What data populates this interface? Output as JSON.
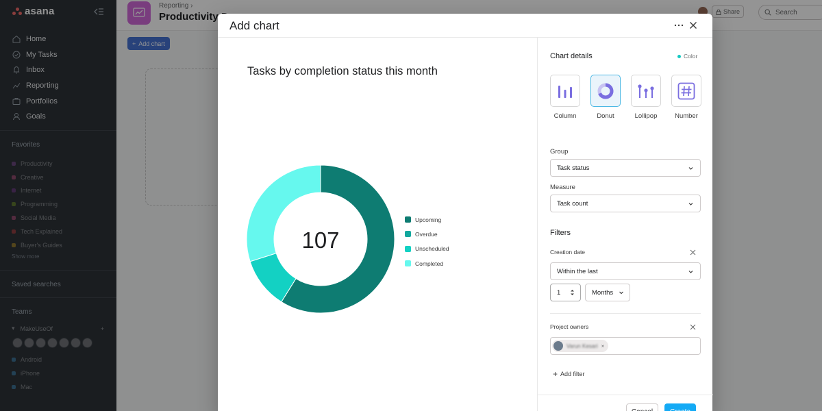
{
  "app": {
    "logo_text": "asana"
  },
  "sidebar": {
    "nav": [
      {
        "label": "Home",
        "icon": "home-icon"
      },
      {
        "label": "My Tasks",
        "icon": "check-circle-icon"
      },
      {
        "label": "Inbox",
        "icon": "bell-icon"
      },
      {
        "label": "Reporting",
        "icon": "trend-icon"
      },
      {
        "label": "Portfolios",
        "icon": "folder-icon"
      },
      {
        "label": "Goals",
        "icon": "person-icon"
      }
    ],
    "favorites_title": "Favorites",
    "favorites": [
      {
        "label": "Productivity",
        "color": "#9b59b6"
      },
      {
        "label": "Creative",
        "color": "#e0609a"
      },
      {
        "label": "Internet",
        "color": "#8e44ad"
      },
      {
        "label": "Programming",
        "color": "#8ab22d"
      },
      {
        "label": "Social Media",
        "color": "#e0609a"
      },
      {
        "label": "Tech Explained",
        "color": "#e54b4b"
      },
      {
        "label": "Buyer's Guides",
        "color": "#e0b12d"
      }
    ],
    "show_more": "Show more",
    "saved_searches": "Saved searches",
    "teams_title": "Teams",
    "team_name": "MakeUseOf",
    "team_projects": [
      {
        "label": "Android",
        "color": "#4aa3df"
      },
      {
        "label": "iPhone",
        "color": "#4aa3df"
      },
      {
        "label": "Mac",
        "color": "#4aa3df"
      }
    ]
  },
  "header": {
    "breadcrumb": "Reporting",
    "title": "Productivity D",
    "share_label": "Share",
    "search_placeholder": "Search",
    "add_chart_label": "Add chart"
  },
  "modal": {
    "title": "Add chart",
    "chart_title": "Tasks by completion status this month",
    "details_title": "Chart details",
    "color_label": "Color",
    "chart_types": [
      {
        "label": "Column",
        "icon": "column-chart-icon",
        "selected": false
      },
      {
        "label": "Donut",
        "icon": "donut-chart-icon",
        "selected": true
      },
      {
        "label": "Lollipop",
        "icon": "lollipop-chart-icon",
        "selected": false
      },
      {
        "label": "Number",
        "icon": "number-chart-icon",
        "selected": false
      }
    ],
    "group_label": "Group",
    "group_value": "Task status",
    "measure_label": "Measure",
    "measure_value": "Task count",
    "filters_title": "Filters",
    "creation_date_label": "Creation date",
    "creation_date_value": "Within the last",
    "number_value": "1",
    "unit_value": "Months",
    "project_owners_label": "Project owners",
    "owner_chip": "Varun Kesari",
    "add_filter_label": "Add filter",
    "cancel_label": "Cancel",
    "create_label": "Create"
  },
  "chart_data": {
    "type": "pie",
    "title": "Tasks by completion status this month",
    "center_value": "107",
    "categories": [
      "Upcoming",
      "Overdue",
      "Unscheduled",
      "Completed"
    ],
    "values": [
      63,
      0,
      12,
      32
    ],
    "colors": [
      "#0e7c72",
      "#13a89e",
      "#13d1c3",
      "#66f8ee"
    ],
    "legend": "right"
  }
}
